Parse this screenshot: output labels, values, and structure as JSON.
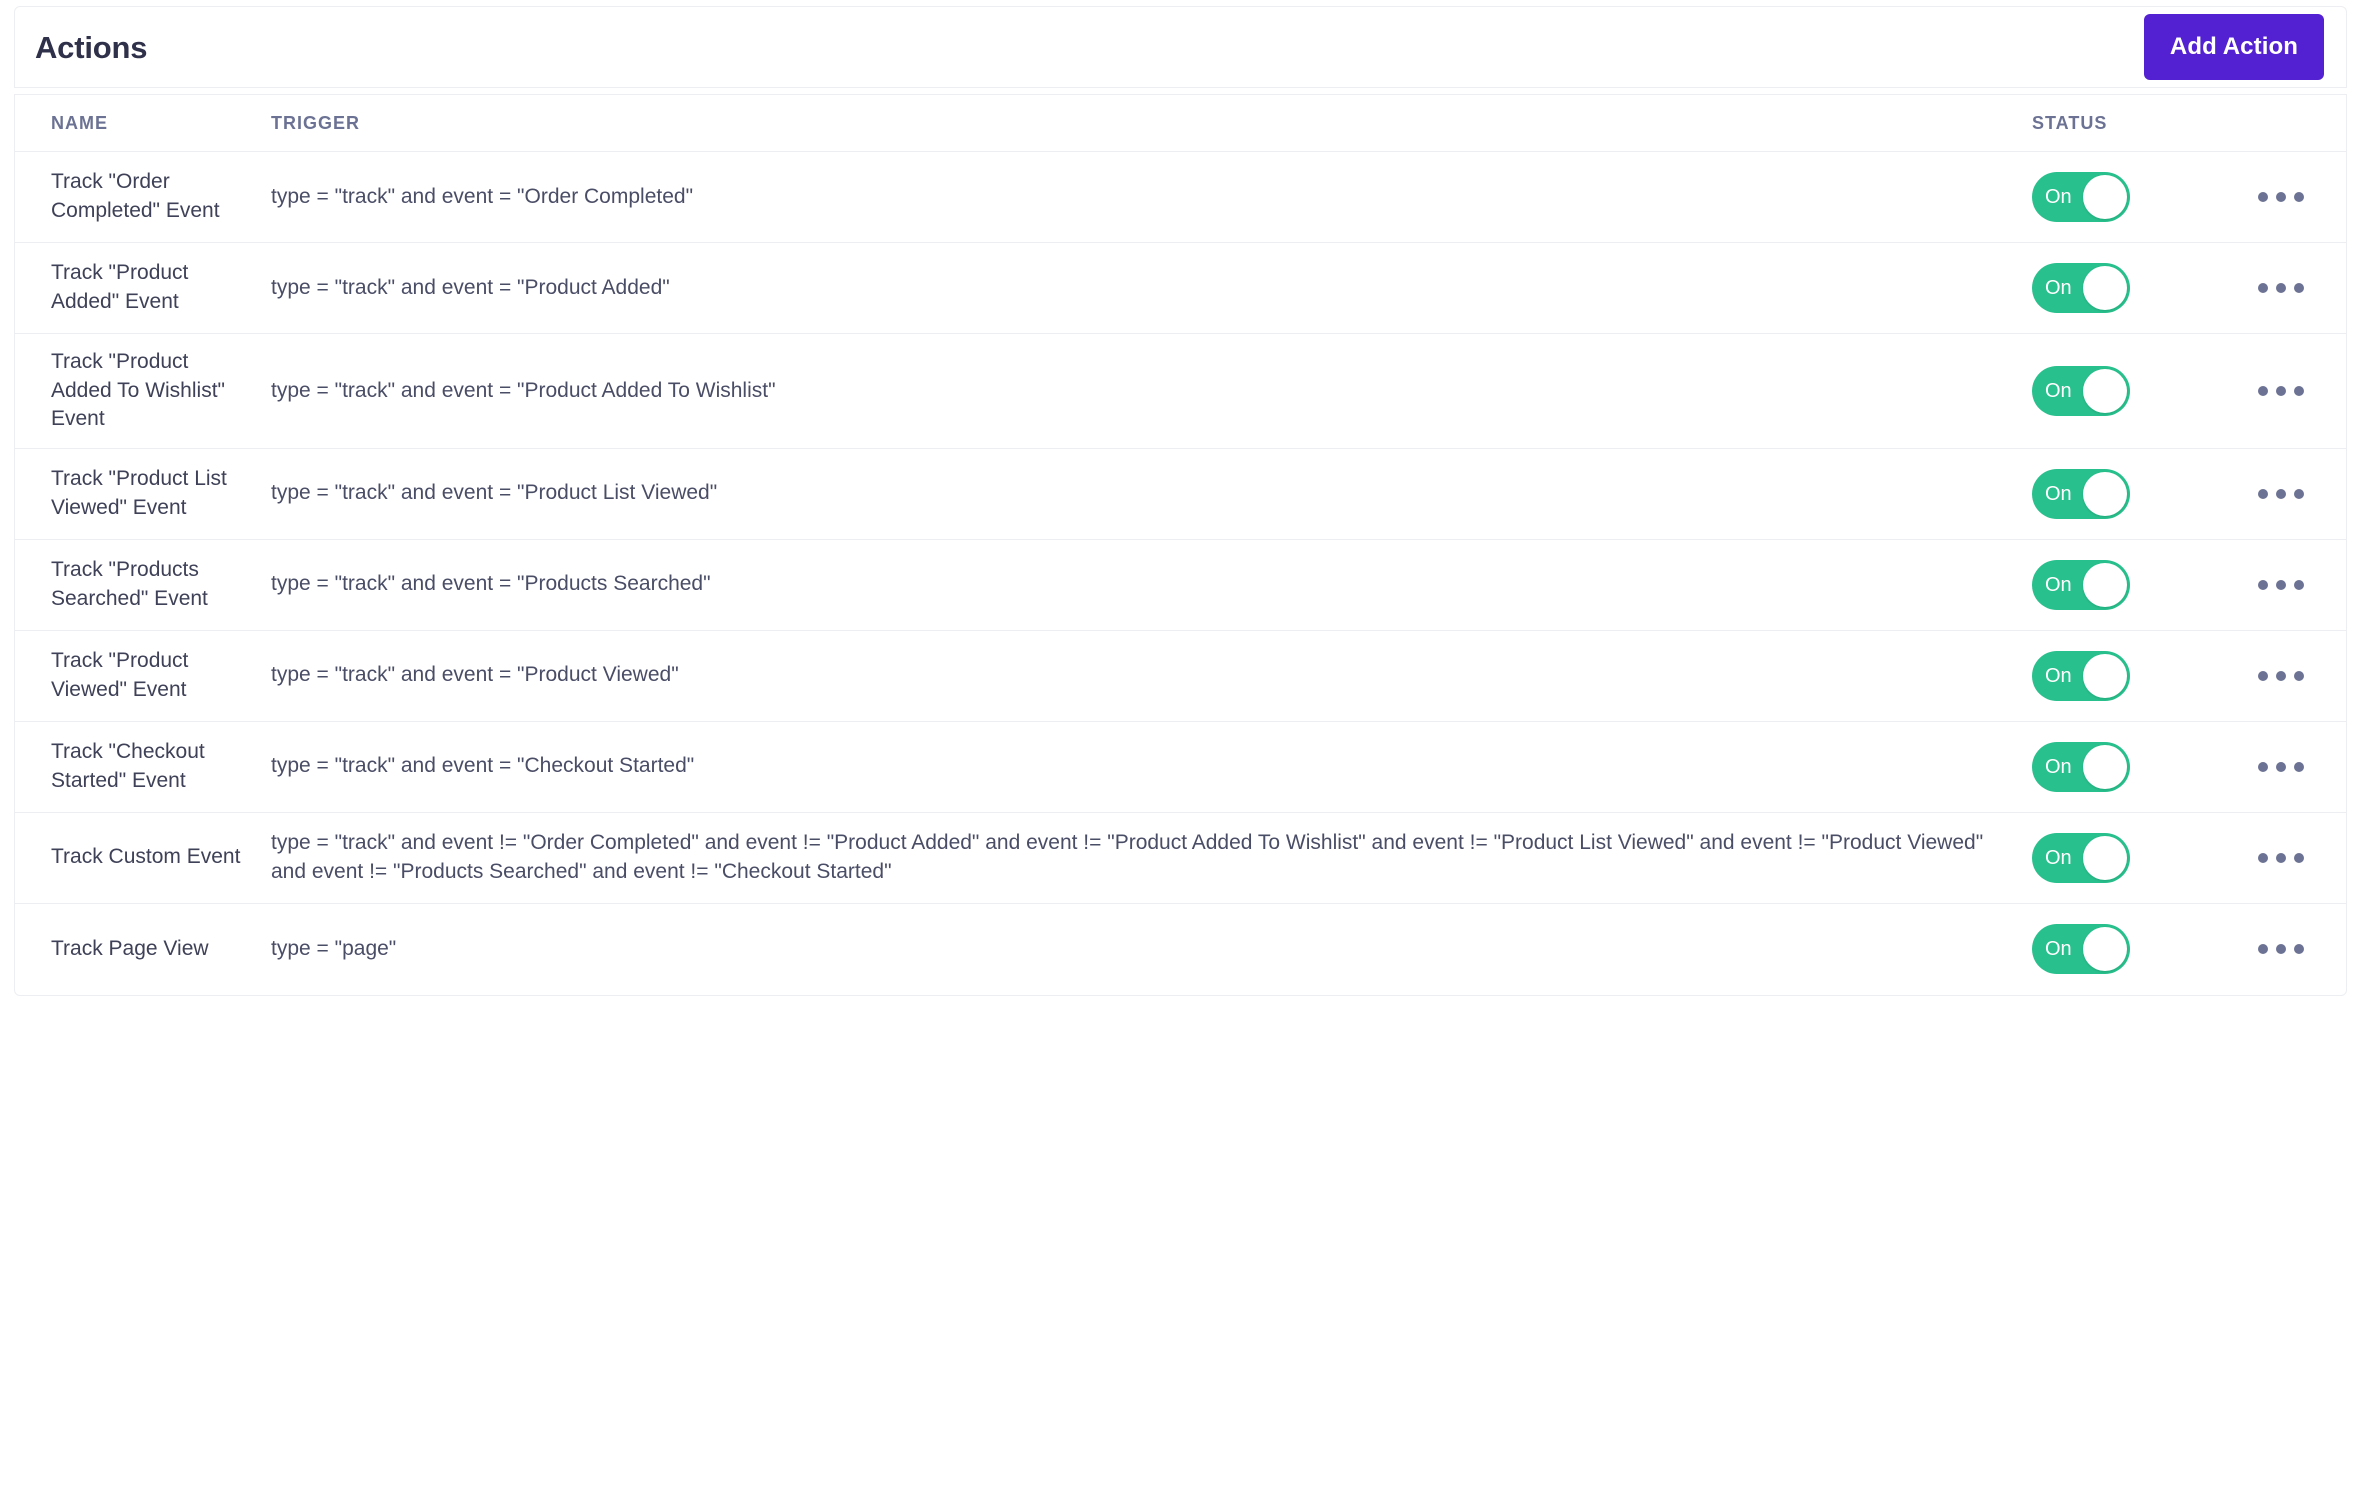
{
  "header": {
    "title": "Actions",
    "add_action_label": "Add Action",
    "accent_color": "#5321d1"
  },
  "table": {
    "columns": {
      "name": "NAME",
      "trigger": "TRIGGER",
      "status": "STATUS"
    },
    "status_on_label": "On",
    "status_on_color": "#28c08c",
    "menu_icon": "kebab-dots-icon",
    "rows": [
      {
        "name": "Track \"Order Completed\" Event",
        "trigger": "type = \"track\" and event = \"Order Completed\"",
        "status": "On"
      },
      {
        "name": "Track \"Product Added\" Event",
        "trigger": "type = \"track\" and event = \"Product Added\"",
        "status": "On"
      },
      {
        "name": "Track \"Product Added To Wishlist\" Event",
        "trigger": "type = \"track\" and event = \"Product Added To Wishlist\"",
        "status": "On"
      },
      {
        "name": "Track \"Product List Viewed\" Event",
        "trigger": "type = \"track\" and event = \"Product List Viewed\"",
        "status": "On"
      },
      {
        "name": "Track \"Products Searched\" Event",
        "trigger": "type = \"track\" and event = \"Products Searched\"",
        "status": "On"
      },
      {
        "name": "Track \"Product Viewed\" Event",
        "trigger": "type = \"track\" and event = \"Product Viewed\"",
        "status": "On"
      },
      {
        "name": "Track \"Checkout Started\" Event",
        "trigger": "type = \"track\" and event = \"Checkout Started\"",
        "status": "On"
      },
      {
        "name": "Track Custom Event",
        "trigger": "type = \"track\" and event != \"Order Completed\" and event != \"Product Added\" and event != \"Product Added To Wishlist\" and event != \"Product List Viewed\" and event != \"Product Viewed\" and event != \"Products Searched\" and event != \"Checkout Started\"",
        "status": "On"
      },
      {
        "name": "Track Page View",
        "trigger": "type = \"page\"",
        "status": "On"
      }
    ]
  }
}
